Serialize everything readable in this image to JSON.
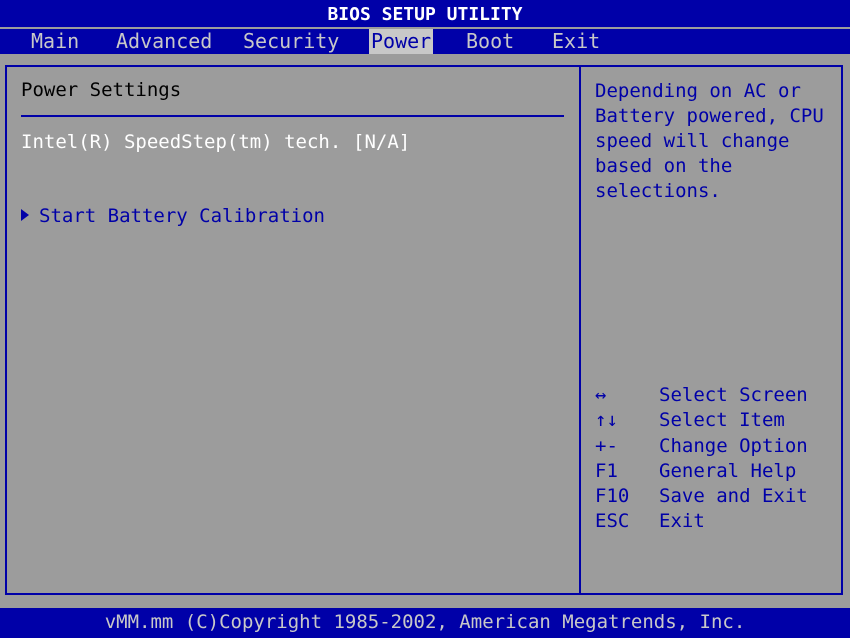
{
  "title": "BIOS SETUP UTILITY",
  "menu": {
    "tabs": [
      {
        "label": "Main"
      },
      {
        "label": "Advanced"
      },
      {
        "label": "Security"
      },
      {
        "label": "Power"
      },
      {
        "label": "Boot"
      },
      {
        "label": "Exit"
      }
    ],
    "active": "Power"
  },
  "panel": {
    "title": "Power Settings",
    "speedstep": {
      "label": "Intel(R) SpeedStep(tm) tech.",
      "value": "[N/A]"
    },
    "submenu": {
      "label": "Start Battery Calibration",
      "icon": "triangle-right-icon"
    }
  },
  "help": {
    "lines": [
      "Depending on AC or",
      "Battery powered, CPU",
      "speed will change",
      "based on the",
      "selections."
    ]
  },
  "keys": [
    {
      "key": "↔",
      "desc": "Select Screen"
    },
    {
      "key": "↑↓",
      "desc": "Select Item"
    },
    {
      "key": "+-",
      "desc": "Change Option"
    },
    {
      "key": "F1",
      "desc": "General Help"
    },
    {
      "key": "F10",
      "desc": "Save and Exit"
    },
    {
      "key": "ESC",
      "desc": "Exit"
    }
  ],
  "footer": "vMM.mm (C)Copyright 1985-2002, American Megatrends, Inc.",
  "colors": {
    "background": "#9c9c9c",
    "blue": "#0000a8",
    "white": "#ffffff"
  }
}
